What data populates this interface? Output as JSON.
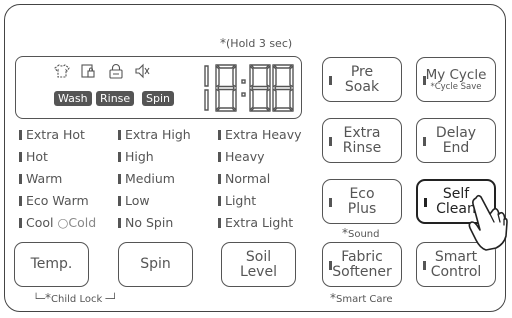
{
  "header": {
    "hold_star": "*",
    "hold_text": "(Hold 3 sec)"
  },
  "display": {
    "indicators": [
      "Wash",
      "Rinse",
      "Spin"
    ],
    "digits": "18:88",
    "icons": [
      "shirt-icon",
      "child-lock-icon",
      "lock-icon",
      "mute-icon"
    ]
  },
  "options": {
    "temp": [
      {
        "label": "Extra Hot"
      },
      {
        "label": "Hot"
      },
      {
        "label": "Warm"
      },
      {
        "label": "Eco Warm"
      },
      {
        "label": "Cool",
        "extra": "○Cold"
      }
    ],
    "spin": [
      "Extra High",
      "High",
      "Medium",
      "Low",
      "No Spin"
    ],
    "soil": [
      "Extra Heavy",
      "Heavy",
      "Normal",
      "Light",
      "Extra Light"
    ]
  },
  "buttons": {
    "temp": "Temp.",
    "spin": "Spin",
    "soil": "Soil\nLevel",
    "pre_soak": "Pre\nSoak",
    "my_cycle": "My Cycle",
    "my_cycle_sub": "*Cycle Save",
    "extra_rinse": "Extra\nRinse",
    "delay_end": "Delay\nEnd",
    "eco_plus": "Eco\nPlus",
    "self_clean": "Self\nClean",
    "fabric_softener": "Fabric\nSoftener",
    "smart_control": "Smart\nControl"
  },
  "notes": {
    "sound_star": "*",
    "sound": "Sound",
    "smart_care_star": "*",
    "smart_care": "Smart Care",
    "child_lock_star": "*",
    "child_lock": "Child Lock"
  }
}
